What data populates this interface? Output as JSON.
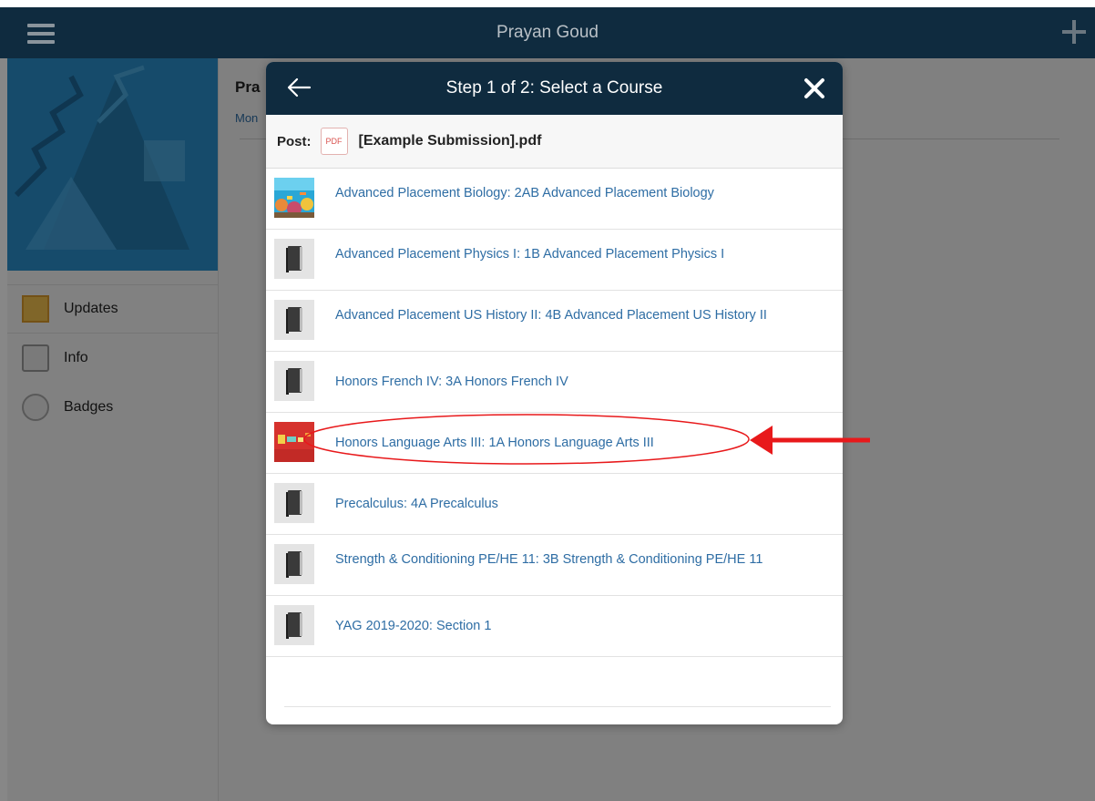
{
  "top_bar": {
    "title": "Prayan Goud"
  },
  "sidebar": {
    "items": [
      {
        "label": "Updates",
        "icon": "updates-icon"
      },
      {
        "label": "Info",
        "icon": "info-icon"
      },
      {
        "label": "Badges",
        "icon": "badges-icon"
      }
    ]
  },
  "main": {
    "title": "Pra",
    "subtitle": "Mon"
  },
  "modal": {
    "title": "Step 1 of 2: Select a Course",
    "post_label": "Post:",
    "pdf_badge": "PDF",
    "file_name": "[Example Submission].pdf",
    "courses": [
      {
        "label": "Advanced Placement Biology: 2AB Advanced Placement Biology",
        "thumb": "coral-reef"
      },
      {
        "label": "Advanced Placement Physics I: 1B Advanced Placement Physics I",
        "thumb": "book"
      },
      {
        "label": "Advanced Placement US History II: 4B Advanced Placement US History II",
        "thumb": "book"
      },
      {
        "label": "Honors French IV: 3A Honors French IV",
        "thumb": "book"
      },
      {
        "label": "Honors Language Arts III: 1A Honors Language Arts III",
        "thumb": "red-art"
      },
      {
        "label": "Precalculus: 4A Precalculus",
        "thumb": "book"
      },
      {
        "label": "Strength & Conditioning PE/HE 11: 3B Strength & Conditioning PE/HE 11",
        "thumb": "book"
      },
      {
        "label": "YAG 2019-2020: Section 1",
        "thumb": "book"
      }
    ]
  },
  "annotation": {
    "color": "#e8191b",
    "highlighted_course": "Honors Language Arts III: 1A Honors Language Arts III"
  }
}
